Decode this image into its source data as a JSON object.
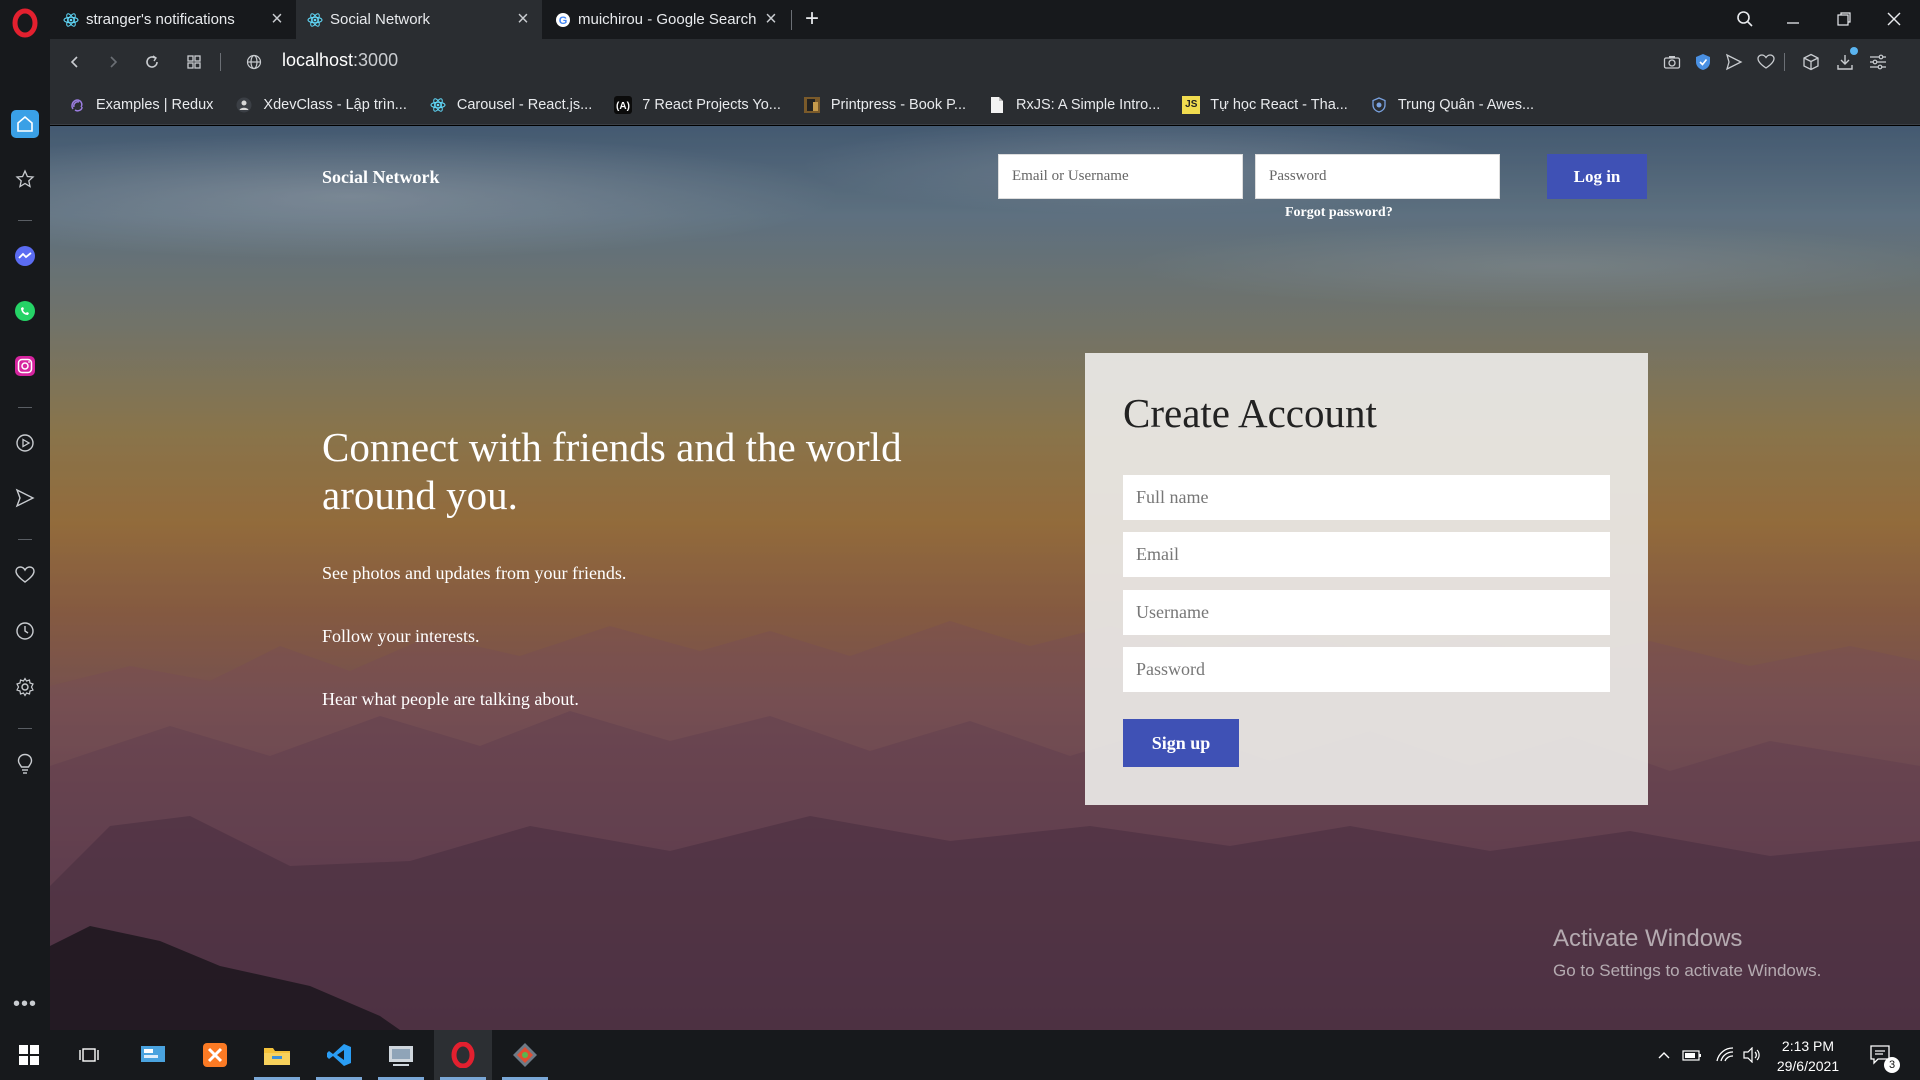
{
  "browser": {
    "tabs": [
      {
        "title": "stranger's notifications",
        "favicon": "react-icon",
        "active": false
      },
      {
        "title": "Social Network",
        "favicon": "react-icon",
        "active": true
      },
      {
        "title": "muichirou - Google Search",
        "favicon": "google-icon",
        "active": false
      }
    ],
    "url": {
      "host": "localhost",
      "port": ":3000"
    },
    "bookmarks": [
      {
        "label": "Examples | Redux",
        "icon": "redux-icon"
      },
      {
        "label": "XdevClass - Lập trìn...",
        "icon": "avatar-icon"
      },
      {
        "label": "Carousel - React.js...",
        "icon": "react-icon"
      },
      {
        "label": "7 React Projects Yo...",
        "icon": "dev-icon"
      },
      {
        "label": "Printpress - Book P...",
        "icon": "book-icon"
      },
      {
        "label": "RxJS: A Simple Intro...",
        "icon": "page-icon"
      },
      {
        "label": "Tự học React - Tha...",
        "icon": "js-icon"
      },
      {
        "label": "Trung Quân - Awes...",
        "icon": "shield-icon"
      }
    ]
  },
  "app": {
    "brand": "Social Network",
    "login": {
      "email_placeholder": "Email or Username",
      "password_placeholder": "Password",
      "button": "Log in",
      "forgot": "Forgot password?"
    },
    "hero": {
      "headline": "Connect with friends and the world around you.",
      "features": [
        "See photos and updates from your friends.",
        "Follow your interests.",
        "Hear what people are talking about."
      ]
    },
    "signup": {
      "title": "Create Account",
      "fields": [
        "Full name",
        "Email",
        "Username",
        "Password"
      ],
      "button": "Sign up"
    },
    "accent_color": "#3f51b5"
  },
  "watermark": {
    "line1": "Activate Windows",
    "line2": "Go to Settings to activate Windows."
  },
  "taskbar": {
    "time": "2:13 PM",
    "date": "29/6/2021",
    "notification_count": "3"
  }
}
